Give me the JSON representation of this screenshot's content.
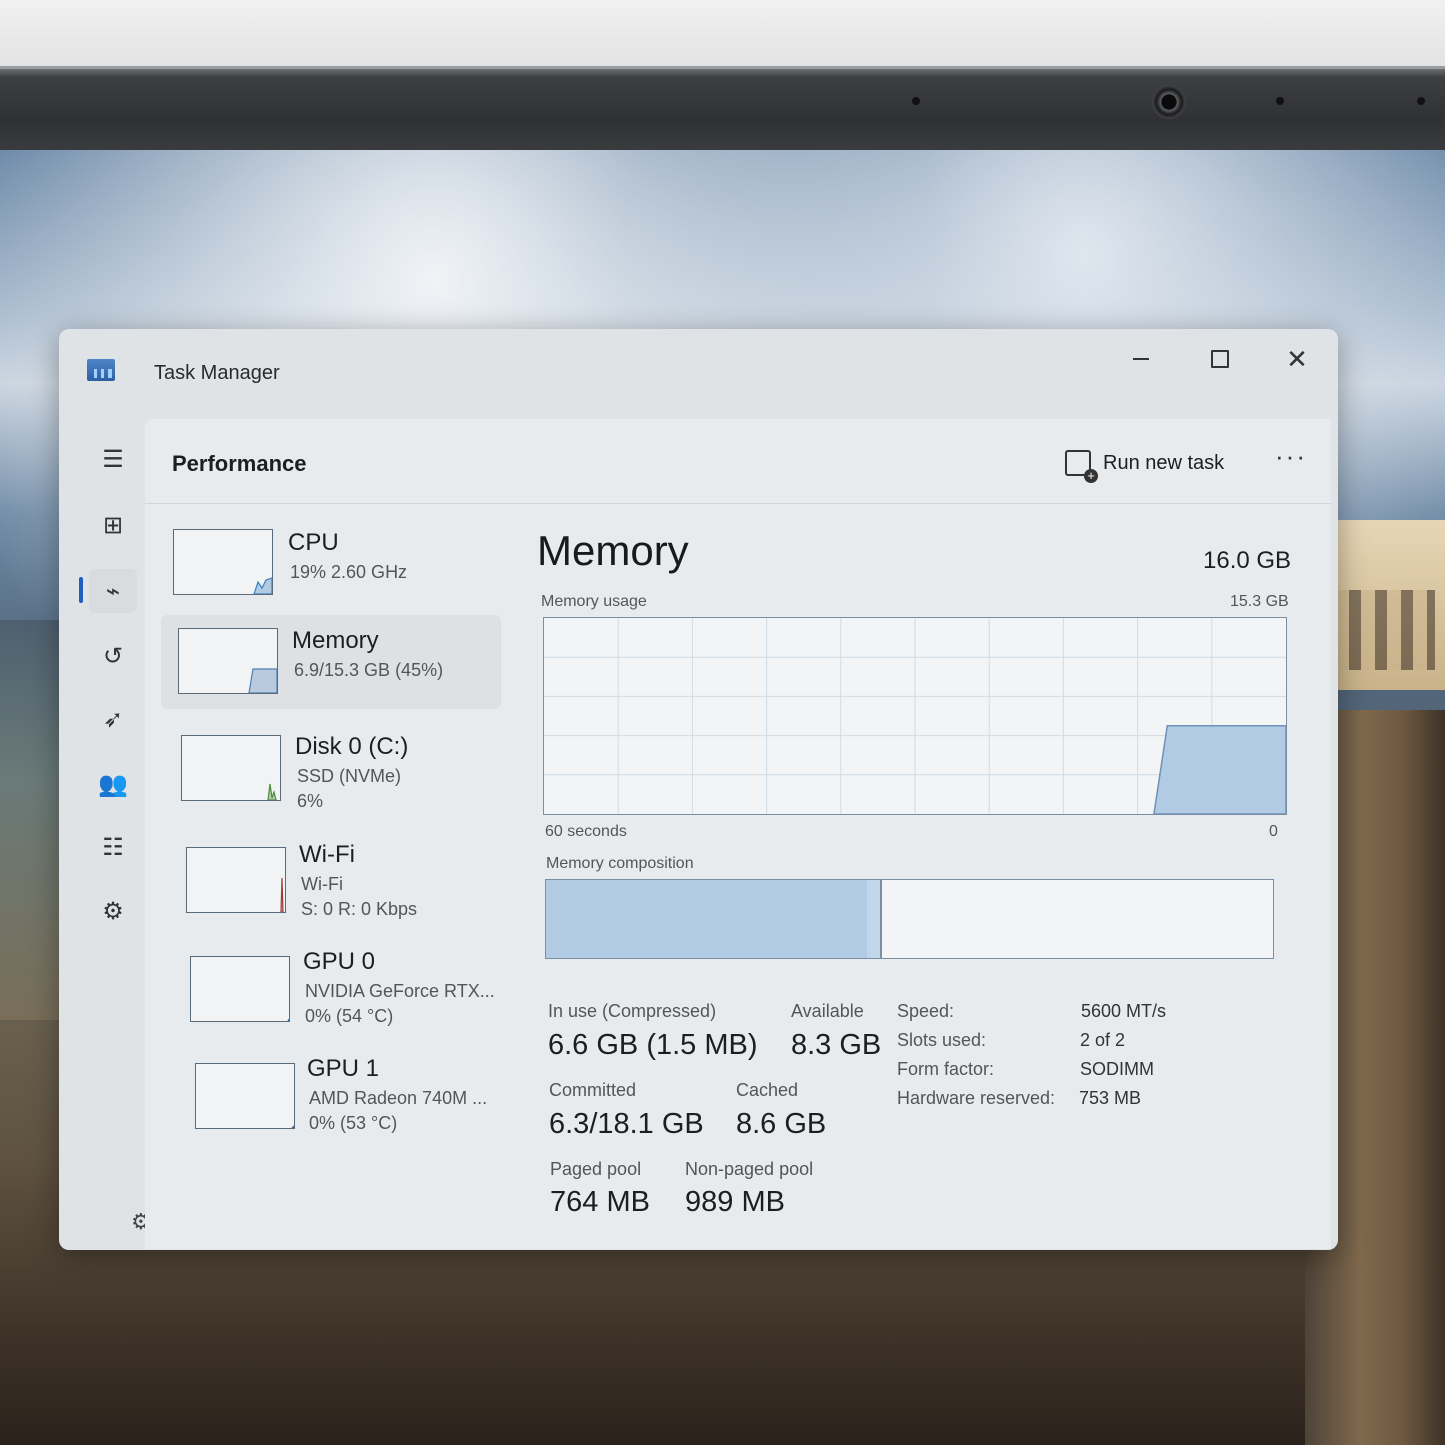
{
  "window": {
    "title": "Task Manager",
    "minimize_glyph": "—",
    "close_glyph": "✕"
  },
  "header": {
    "title": "Performance",
    "run_new_task": "Run new task",
    "more_glyph": "···"
  },
  "nav": {
    "items": [
      {
        "name": "menu-icon",
        "glyph": "☰"
      },
      {
        "name": "processes-icon",
        "glyph": "⊞"
      },
      {
        "name": "performance-icon",
        "glyph": "⌁"
      },
      {
        "name": "app-history-icon",
        "glyph": "↺"
      },
      {
        "name": "startup-apps-icon",
        "glyph": "➶"
      },
      {
        "name": "users-icon",
        "glyph": "👥"
      },
      {
        "name": "details-icon",
        "glyph": "☷"
      },
      {
        "name": "services-icon",
        "glyph": "⚙"
      }
    ],
    "settings_glyph": "⚙"
  },
  "devices": [
    {
      "name": "CPU",
      "line1": "19%  2.60 GHz",
      "line2": "",
      "color": "#3b82c4"
    },
    {
      "name": "Memory",
      "line1": "6.9/15.3 GB (45%)",
      "line2": "",
      "color": "#4f7fb6",
      "selected": true
    },
    {
      "name": "Disk 0 (C:)",
      "line1": "SSD (NVMe)",
      "line2": "6%",
      "color": "#4c8a3c"
    },
    {
      "name": "Wi-Fi",
      "line1": "Wi-Fi",
      "line2": "S: 0  R: 0 Kbps",
      "color": "#a23b3b"
    },
    {
      "name": "GPU 0",
      "line1": "NVIDIA GeForce RTX...",
      "line2": "0%  (54 °C)",
      "color": "#3b6fb0"
    },
    {
      "name": "GPU 1",
      "line1": "AMD Radeon 740M ...",
      "line2": "0%  (53 °C)",
      "color": "#3b6fb0"
    }
  ],
  "memory": {
    "title": "Memory",
    "total": "16.0 GB",
    "usage_label": "Memory usage",
    "usage_max": "15.3 GB",
    "time_label": "60 seconds",
    "time_end": "0",
    "usage_fraction": 0.45,
    "composition_label": "Memory composition",
    "composition_inuse_fraction": 0.441,
    "composition_modified_fraction": 0.019,
    "in_use_label": "In use (Compressed)",
    "in_use_value": "6.6 GB (1.5 MB)",
    "available_label": "Available",
    "available_value": "8.3 GB",
    "committed_label": "Committed",
    "committed_value": "6.3/18.1 GB",
    "cached_label": "Cached",
    "cached_value": "8.6 GB",
    "paged_label": "Paged pool",
    "paged_value": "764 MB",
    "nonpaged_label": "Non-paged pool",
    "nonpaged_value": "989 MB",
    "specs": [
      {
        "label": "Speed:",
        "value": "5600 MT/s"
      },
      {
        "label": "Slots used:",
        "value": "2 of 2"
      },
      {
        "label": "Form factor:",
        "value": "SODIMM"
      },
      {
        "label": "Hardware reserved:",
        "value": "753 MB"
      }
    ]
  },
  "colors": {
    "accent": "#1f5fbf",
    "graph_fill": "#b2cbe4",
    "graph_stroke": "#6f93b8",
    "grid": "#cfdce6"
  }
}
